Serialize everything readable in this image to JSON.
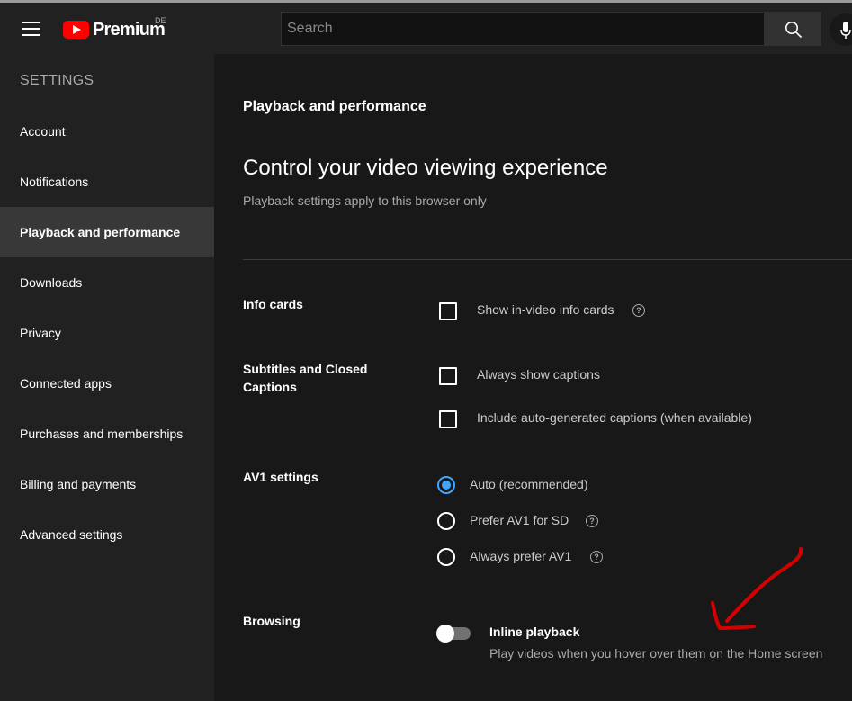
{
  "topbar": {
    "logo_text": "Premium",
    "logo_region": "DE",
    "search_placeholder": "Search"
  },
  "sidebar": {
    "heading": "SETTINGS",
    "items": [
      {
        "label": "Account"
      },
      {
        "label": "Notifications"
      },
      {
        "label": "Playback and performance",
        "active": true
      },
      {
        "label": "Downloads"
      },
      {
        "label": "Privacy"
      },
      {
        "label": "Connected apps"
      },
      {
        "label": "Purchases and memberships"
      },
      {
        "label": "Billing and payments"
      },
      {
        "label": "Advanced settings"
      }
    ]
  },
  "main": {
    "section_title": "Playback and performance",
    "headline": "Control your video viewing experience",
    "subhead": "Playback settings apply to this browser only",
    "info_cards": {
      "label": "Info cards",
      "options": [
        {
          "label": "Show in-video info cards",
          "checked": false
        }
      ]
    },
    "subtitles": {
      "label": "Subtitles and Closed Captions",
      "options": [
        {
          "label": "Always show captions",
          "checked": false
        },
        {
          "label": "Include auto-generated captions (when available)",
          "checked": false
        }
      ]
    },
    "av1": {
      "label": "AV1 settings",
      "options": [
        {
          "label": "Auto (recommended)",
          "selected": true
        },
        {
          "label": "Prefer AV1 for SD",
          "selected": false
        },
        {
          "label": "Always prefer AV1",
          "selected": false
        }
      ]
    },
    "browsing": {
      "label": "Browsing",
      "toggle_title": "Inline playback",
      "toggle_desc": "Play videos when you hover over them on the Home screen",
      "toggle_on": false
    }
  },
  "help_glyph": "?",
  "colors": {
    "accent": "#3ea6ff",
    "brand_red": "#ff0000",
    "annotation": "#d40000"
  }
}
